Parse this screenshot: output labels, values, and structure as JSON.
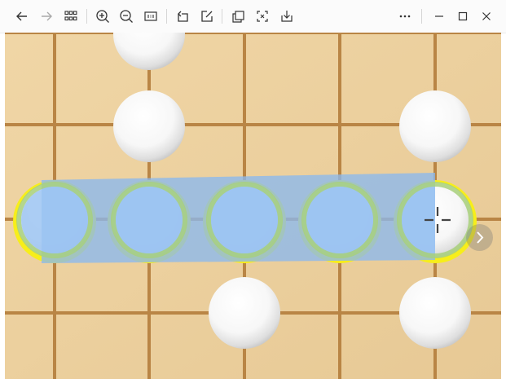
{
  "toolbar": {
    "buttons": [
      {
        "id": "back",
        "icon": "back-arrow-icon"
      },
      {
        "id": "forward",
        "icon": "forward-arrow-icon"
      },
      {
        "id": "gallery",
        "icon": "grid-icon"
      },
      {
        "id": "zoom_in",
        "icon": "zoom-in-icon"
      },
      {
        "id": "zoom_out",
        "icon": "zoom-out-icon"
      },
      {
        "id": "actual_size",
        "icon": "actual-size-icon",
        "label": "1:1"
      },
      {
        "id": "rotate",
        "icon": "rotate-icon"
      },
      {
        "id": "edit",
        "icon": "edit-icon"
      },
      {
        "id": "copy",
        "icon": "copy-icon"
      },
      {
        "id": "crop",
        "icon": "crop-icon"
      },
      {
        "id": "save",
        "icon": "save-download-icon"
      },
      {
        "id": "more",
        "icon": "more-icon",
        "label": "···"
      }
    ]
  },
  "window_controls": {
    "minimize": "–",
    "maximize": "☐",
    "close": "✕"
  },
  "viewer": {
    "board_color": "#ecd29f",
    "grid_color": "#b98545",
    "white_stone_color": "#ffffff",
    "highlight_ring_color": "#f7ee1a",
    "selection_color": "#8ab8ee",
    "selection_ring_color": "#a8d07a",
    "next_icon": "chevron-right-icon"
  }
}
